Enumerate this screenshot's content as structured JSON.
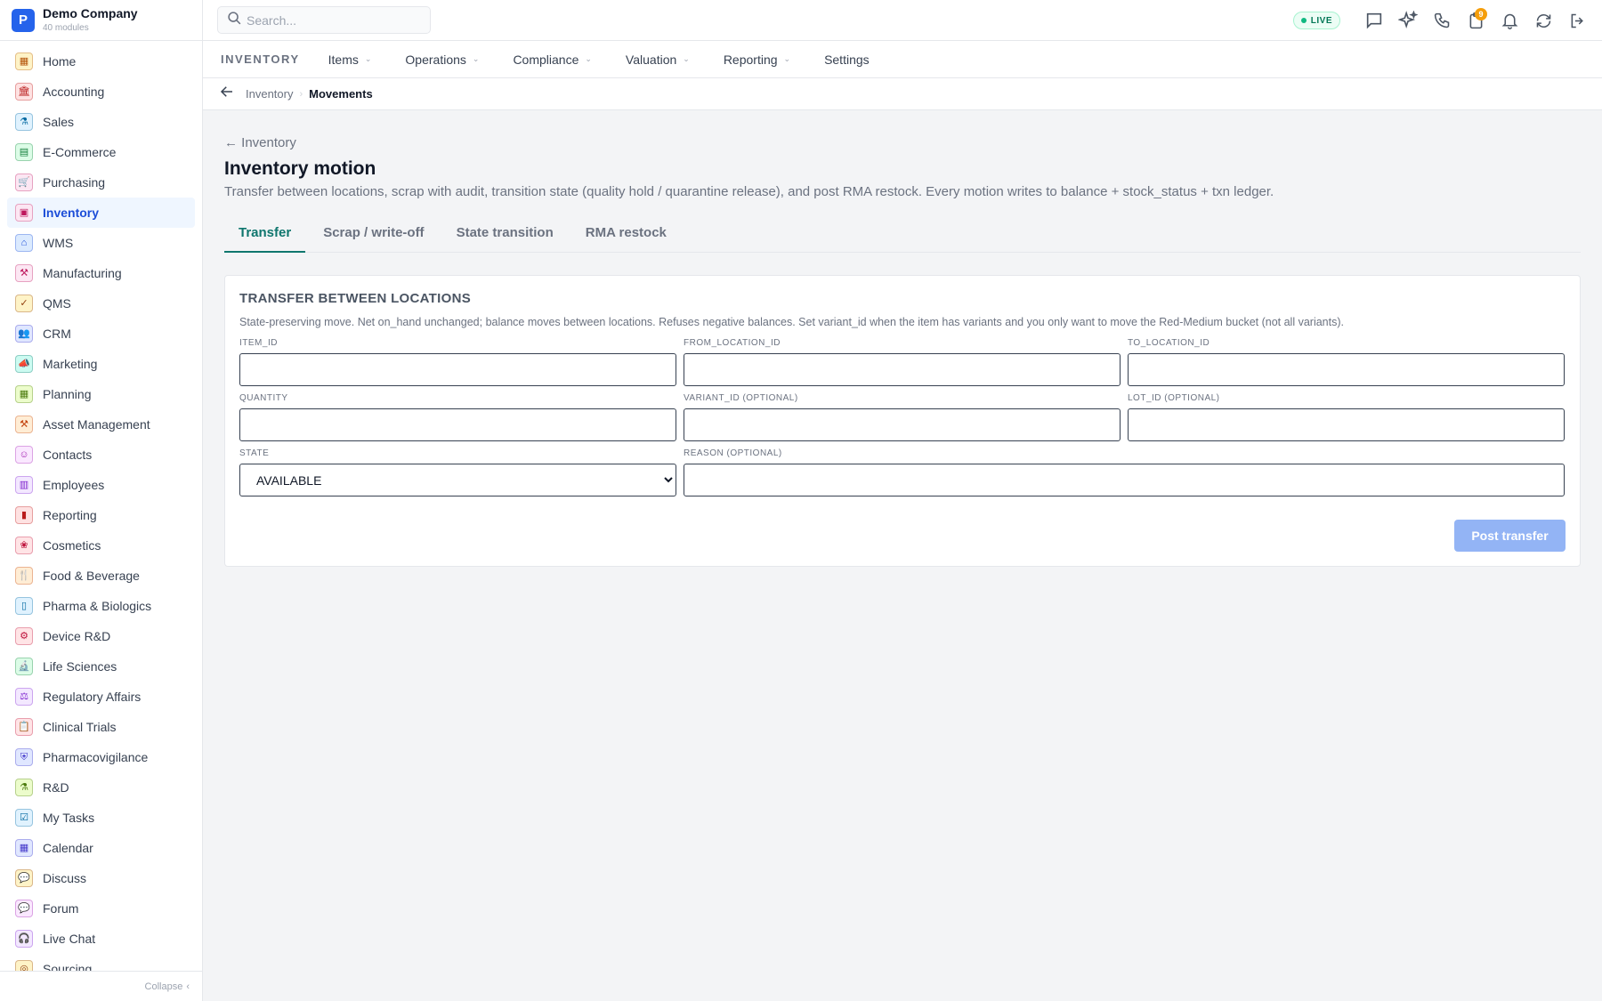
{
  "brand": {
    "letter": "P",
    "name": "Demo Company",
    "sub": "40 modules"
  },
  "sidebar": {
    "items": [
      {
        "label": "Home",
        "icon": "grid-icon",
        "glyph": "▦",
        "color": "#b45309",
        "bg": "#fef3c7"
      },
      {
        "label": "Accounting",
        "icon": "bank-icon",
        "glyph": "🏛",
        "color": "#b91c1c",
        "bg": "#fee2e2"
      },
      {
        "label": "Sales",
        "icon": "flask-icon",
        "glyph": "⚗",
        "color": "#0369a1",
        "bg": "#e0f2fe"
      },
      {
        "label": "E-Commerce",
        "icon": "store-icon",
        "glyph": "▤",
        "color": "#15803d",
        "bg": "#dcfce7"
      },
      {
        "label": "Purchasing",
        "icon": "cart-icon",
        "glyph": "🛒",
        "color": "#be185d",
        "bg": "#fce7f3"
      },
      {
        "label": "Inventory",
        "icon": "archive-icon",
        "glyph": "▣",
        "color": "#be185d",
        "bg": "#fce7f3",
        "active": true
      },
      {
        "label": "WMS",
        "icon": "warehouse-icon",
        "glyph": "⌂",
        "color": "#1d4ed8",
        "bg": "#dbeafe"
      },
      {
        "label": "Manufacturing",
        "icon": "factory-icon",
        "glyph": "⚒",
        "color": "#be185d",
        "bg": "#fce7f3"
      },
      {
        "label": "QMS",
        "icon": "check-badge-icon",
        "glyph": "✓",
        "color": "#92400e",
        "bg": "#fef3c7"
      },
      {
        "label": "CRM",
        "icon": "users-icon",
        "glyph": "👥",
        "color": "#4338ca",
        "bg": "#e0e7ff"
      },
      {
        "label": "Marketing",
        "icon": "megaphone-icon",
        "glyph": "📣",
        "color": "#0f766e",
        "bg": "#ccfbf1"
      },
      {
        "label": "Planning",
        "icon": "calendar-grid-icon",
        "glyph": "▦",
        "color": "#4d7c0f",
        "bg": "#ecfccb"
      },
      {
        "label": "Asset Management",
        "icon": "tools-icon",
        "glyph": "⚒",
        "color": "#c2410c",
        "bg": "#ffedd5"
      },
      {
        "label": "Contacts",
        "icon": "contact-icon",
        "glyph": "☺",
        "color": "#a21caf",
        "bg": "#fae8ff"
      },
      {
        "label": "Employees",
        "icon": "briefcase-icon",
        "glyph": "▥",
        "color": "#7e22ce",
        "bg": "#f3e8ff"
      },
      {
        "label": "Reporting",
        "icon": "bar-chart-icon",
        "glyph": "▮",
        "color": "#b91c1c",
        "bg": "#fee2e2"
      },
      {
        "label": "Cosmetics",
        "icon": "flower-icon",
        "glyph": "❀",
        "color": "#be123c",
        "bg": "#ffe4e6"
      },
      {
        "label": "Food & Beverage",
        "icon": "utensils-icon",
        "glyph": "🍴",
        "color": "#c2410c",
        "bg": "#ffedd5"
      },
      {
        "label": "Pharma & Biologics",
        "icon": "pill-icon",
        "glyph": "▯",
        "color": "#0369a1",
        "bg": "#e0f2fe"
      },
      {
        "label": "Device R&D",
        "icon": "cog-icon",
        "glyph": "⚙",
        "color": "#be123c",
        "bg": "#ffe4e6"
      },
      {
        "label": "Life Sciences",
        "icon": "microscope-icon",
        "glyph": "🔬",
        "color": "#15803d",
        "bg": "#dcfce7"
      },
      {
        "label": "Regulatory Affairs",
        "icon": "gavel-icon",
        "glyph": "⚖",
        "color": "#7e22ce",
        "bg": "#f3e8ff"
      },
      {
        "label": "Clinical Trials",
        "icon": "clipboard-icon",
        "glyph": "📋",
        "color": "#be123c",
        "bg": "#ffe4e6"
      },
      {
        "label": "Pharmacovigilance",
        "icon": "shield-icon",
        "glyph": "⛨",
        "color": "#4338ca",
        "bg": "#e0e7ff"
      },
      {
        "label": "R&D",
        "icon": "beaker-icon",
        "glyph": "⚗",
        "color": "#4d7c0f",
        "bg": "#ecfccb"
      },
      {
        "label": "My Tasks",
        "icon": "checklist-icon",
        "glyph": "☑",
        "color": "#0369a1",
        "bg": "#e0f2fe"
      },
      {
        "label": "Calendar",
        "icon": "calendar-icon",
        "glyph": "▦",
        "color": "#4338ca",
        "bg": "#e0e7ff"
      },
      {
        "label": "Discuss",
        "icon": "chat-icon",
        "glyph": "💬",
        "color": "#92400e",
        "bg": "#fef3c7"
      },
      {
        "label": "Forum",
        "icon": "forum-icon",
        "glyph": "💬",
        "color": "#a21caf",
        "bg": "#fae8ff"
      },
      {
        "label": "Live Chat",
        "icon": "headset-icon",
        "glyph": "🎧",
        "color": "#7e22ce",
        "bg": "#f3e8ff"
      },
      {
        "label": "Sourcing",
        "icon": "sourcing-icon",
        "glyph": "◎",
        "color": "#92400e",
        "bg": "#fef3c7"
      }
    ],
    "collapse_label": "Collapse"
  },
  "topbar": {
    "search_placeholder": "Search...",
    "live_label": "LIVE",
    "notification_badge": "9"
  },
  "modnav": {
    "title": "INVENTORY",
    "items": [
      "Items",
      "Operations",
      "Compliance",
      "Valuation",
      "Reporting",
      "Settings"
    ]
  },
  "breadcrumb": {
    "parent": "Inventory",
    "current": "Movements"
  },
  "page": {
    "back_link": "← Inventory",
    "title": "Inventory motion",
    "description": "Transfer between locations, scrap with audit, transition state (quality hold / quarantine release), and post RMA restock. Every motion writes to balance + stock_status + txn ledger."
  },
  "tabs": [
    "Transfer",
    "Scrap / write-off",
    "State transition",
    "RMA restock"
  ],
  "card": {
    "title": "TRANSFER BETWEEN LOCATIONS",
    "description": "State-preserving move. Net on_hand unchanged; balance moves between locations. Refuses negative balances. Set variant_id when the item has variants and you only want to move the Red-Medium bucket (not all variants).",
    "fields": {
      "item_id": {
        "label": "ITEM_ID",
        "value": ""
      },
      "from_location_id": {
        "label": "FROM_LOCATION_ID",
        "value": ""
      },
      "to_location_id": {
        "label": "TO_LOCATION_ID",
        "value": ""
      },
      "quantity": {
        "label": "QUANTITY",
        "value": ""
      },
      "variant_id": {
        "label": "VARIANT_ID (OPTIONAL)",
        "value": ""
      },
      "lot_id": {
        "label": "LOT_ID (OPTIONAL)",
        "value": ""
      },
      "state": {
        "label": "STATE",
        "value": "AVAILABLE"
      },
      "reason": {
        "label": "REASON (OPTIONAL)",
        "value": ""
      }
    },
    "submit_label": "Post transfer"
  }
}
